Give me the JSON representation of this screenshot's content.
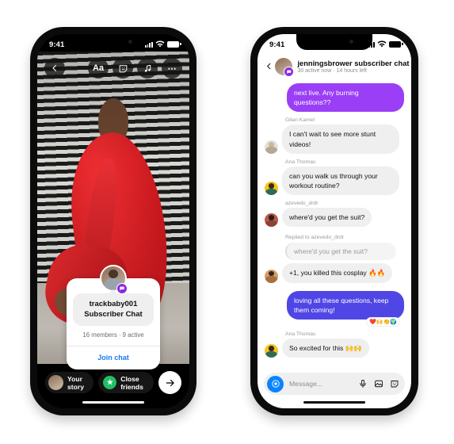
{
  "colors": {
    "purple_bubble": "#9a3ff5",
    "blue_bubble": "#4f46e5",
    "badge_purple": "#8a2be2",
    "join_link_blue": "#1878f3",
    "close_friends_green": "#21c063",
    "camera_blue": "#0a84ff",
    "page_background": "#ffffff"
  },
  "left_phone": {
    "status_bar": {
      "time": "9:41",
      "signal": "signal-bars-icon",
      "wifi": "wifi-icon",
      "battery": "battery-icon"
    },
    "story": {
      "back_icon": "chevron-left-icon",
      "tools": [
        {
          "name": "text-tool",
          "label": "Aa"
        },
        {
          "name": "sticker-tool",
          "label": "sticker-icon"
        },
        {
          "name": "music-tool",
          "label": "music-note-icon"
        },
        {
          "name": "more-tool",
          "label": "⋯"
        }
      ],
      "card": {
        "avatar": "account-avatar",
        "badge_icon": "broadcast-chat-icon",
        "title_line1": "trackbaby001",
        "title_line2": "Subscriber Chat",
        "meta": "16 members · 9 active",
        "join_label": "Join chat"
      },
      "bottom": {
        "your_story_label": "Your story",
        "close_friends_label": "Close friends",
        "close_friends_icon": "green-star-icon",
        "send_icon": "arrow-right-icon"
      }
    }
  },
  "right_phone": {
    "status_bar": {
      "time": "9:41",
      "signal": "signal-bars-icon",
      "wifi": "wifi-icon",
      "battery": "battery-icon"
    },
    "header": {
      "back_icon": "chevron-left-icon",
      "badge_icon": "broadcast-chat-icon",
      "title": "jenningsbrower subscriber chat",
      "subtitle": "30 active now · 14 hours left"
    },
    "messages": [
      {
        "kind": "outgoing-purple",
        "text": "next live. Any burning questions??"
      },
      {
        "kind": "incoming",
        "sender": "Gilan Kamel",
        "text": "I can't wait to see more stunt videos!",
        "avatar_hair": "#cbb6a0",
        "avatar_body": "#e4e0da"
      },
      {
        "kind": "incoming",
        "sender": "Ana Thomas",
        "text": "can you walk us through your workout routine?",
        "avatar_hair": "#3a2a1c",
        "avatar_body": "#f5c518"
      },
      {
        "kind": "incoming",
        "sender": "azevedo_drdr",
        "text": "where'd you get the suit?",
        "avatar_hair": "#2b1d16",
        "avatar_body": "#b9594b"
      },
      {
        "kind": "reply",
        "reply_label": "Replied to azevedo_drdr",
        "quote": "where'd you get the suit?",
        "text": "+1, you killed this cosplay 🔥🔥",
        "avatar_hair": "#3a2417",
        "avatar_body": "#d2a06a"
      },
      {
        "kind": "outgoing-blue",
        "text": "loving all these questions, keep them coming!",
        "reactions": "❤️🙌👏🌍"
      },
      {
        "kind": "incoming",
        "sender": "Ana Thomas",
        "text": "So excited for this 🙌🙌",
        "avatar_hair": "#3a2a1c",
        "avatar_body": "#f5c518"
      }
    ],
    "composer": {
      "camera_icon": "camera-icon",
      "placeholder": "Message...",
      "mic_icon": "microphone-icon",
      "image_icon": "image-icon",
      "sticker_icon": "sticker-icon"
    }
  }
}
